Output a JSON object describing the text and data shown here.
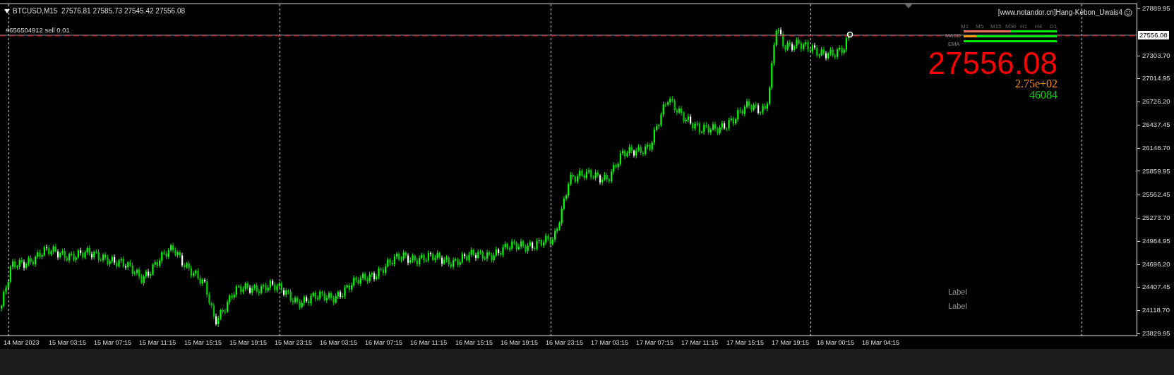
{
  "chart": {
    "header": "BTCUSD,M15  27576.81 27585.73 27545.42 27556.08",
    "order_label": "#656504912 sell 0.01",
    "indicator_title": "[www.notandor.cn]Hang-Kebon_Uwais4",
    "panel": {
      "timeframes": [
        "M1",
        "M5",
        "M15",
        "M30",
        "H1",
        "H4",
        "D1"
      ],
      "row_labels": [
        "MACD",
        "EMA"
      ],
      "bars": [
        {
          "segments": [
            {
              "color": "#f0705a",
              "level": 0.5
            },
            {
              "color": "#00ee00",
              "level": 0.5
            }
          ]
        },
        {
          "segments": [
            {
              "color": "#ff9900",
              "level": 0.14
            },
            {
              "color": "#00ee00",
              "level": 0.86
            }
          ]
        },
        {
          "segments": [
            {
              "color": "#00ee00",
              "level": 1
            }
          ]
        }
      ]
    },
    "big_price": "27556.08",
    "spread": "2.75e+02",
    "volume": "46084",
    "labels": [
      "Label",
      "Label"
    ],
    "current_price": "27556.08",
    "price_axis": [
      "27889.95",
      "27303.70",
      "27014.95",
      "26726.20",
      "26437.45",
      "26148.70",
      "25859.95",
      "25562.45",
      "25273.70",
      "24984.95",
      "24696.20",
      "24407.45",
      "24118.70",
      "23829.95"
    ],
    "time_axis": [
      "14 Mar 2023",
      "15 Mar 03:15",
      "15 Mar 07:15",
      "15 Mar 11:15",
      "15 Mar 15:15",
      "15 Mar 19:15",
      "15 Mar 23:15",
      "16 Mar 03:15",
      "16 Mar 07:15",
      "16 Mar 11:15",
      "16 Mar 15:15",
      "16 Mar 19:15",
      "16 Mar 23:15",
      "17 Mar 03:15",
      "17 Mar 07:15",
      "17 Mar 11:15",
      "17 Mar 15:15",
      "17 Mar 19:15",
      "18 Mar 00:15",
      "18 Mar 04:15"
    ]
  }
}
